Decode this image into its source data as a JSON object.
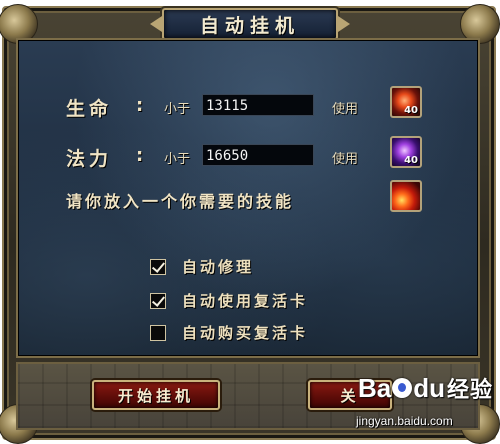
{
  "dialog": {
    "title": "自动挂机"
  },
  "hp_row": {
    "label": "生命",
    "colon": ":",
    "condition": "小于",
    "value": "13115",
    "use_label": "使用",
    "item_icon": "red-potion-icon",
    "item_count": "40"
  },
  "mp_row": {
    "label": "法力",
    "colon": ":",
    "condition": "小于",
    "value": "16650",
    "use_label": "使用",
    "item_icon": "purple-potion-icon",
    "item_count": "40"
  },
  "skill_row": {
    "label": "请你放入一个你需要的技能",
    "skill_icon": "fire-skill-icon"
  },
  "options": [
    {
      "label": "自动修理",
      "checked": true
    },
    {
      "label": "自动使用复活卡",
      "checked": true
    },
    {
      "label": "自动购买复活卡",
      "checked": false
    }
  ],
  "buttons": {
    "start": "开始挂机",
    "close": "关"
  },
  "watermark": {
    "logo_left": "Ba",
    "logo_right": "du",
    "brand_text": "经验",
    "url": "jingyan.baidu.com"
  },
  "colors": {
    "panel_blue": "#1c2b3d",
    "frame_gold": "#b9a574",
    "button_red": "#8a1a12",
    "label_cream": "#f0e4c4"
  }
}
